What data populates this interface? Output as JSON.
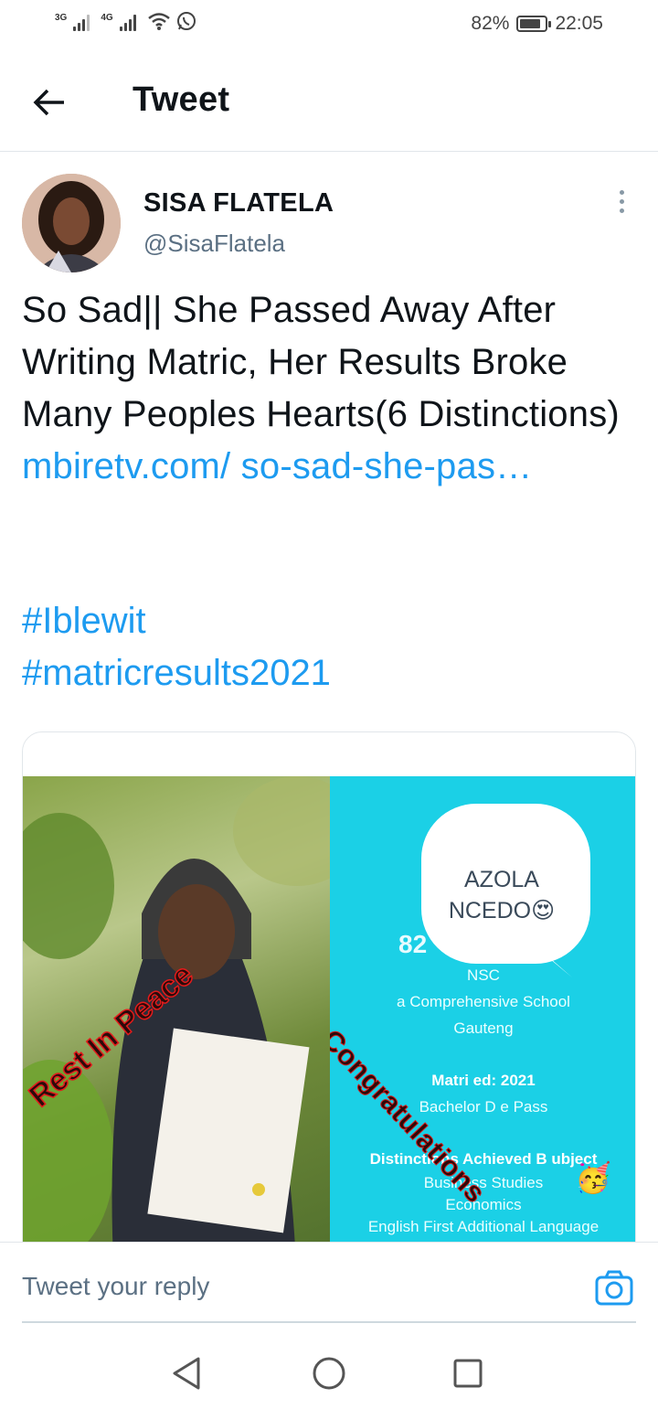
{
  "status_bar": {
    "network1": "3G",
    "network2": "4G",
    "battery_percent": "82%",
    "battery_level": 0.82,
    "time": "22:05",
    "icons": [
      "signal-icon",
      "signal-icon",
      "wifi-icon",
      "whatsapp-icon",
      "battery-icon"
    ]
  },
  "header": {
    "title": "Tweet",
    "back_icon": "arrow-left-icon"
  },
  "tweet": {
    "author_name": "SISA FLATELA",
    "author_handle": "@SisaFlatela",
    "text": "So Sad|| She Passed Away After Writing Matric, Her Results Broke Many Peoples Hearts(6 Distinctions) ",
    "link": "mbiretv.com/ so-sad-she-pas…",
    "hashtags": [
      "#Iblewit",
      "#matricresults2021"
    ],
    "accent_color": "#1d9bf0"
  },
  "media": {
    "left_overlay": "Rest In Peace",
    "right": {
      "name_line1": "AZOLA",
      "name_line2": "NCEDO",
      "partial_number": "82",
      "nsc": "NSC",
      "school": "a Comprehensive School",
      "province": "Gauteng",
      "matric_year": "Matri     ed: 2021",
      "pass": "Bachelor D       e Pass",
      "distinctions_heading": "Distinctions Achieved B   ubject",
      "subjects": [
        "Business Studies",
        "Economics",
        "English First Additional Language"
      ],
      "overlay": "Congratulations",
      "background_color": "#1bd0e6"
    }
  },
  "reply": {
    "placeholder": "Tweet your reply",
    "camera_icon": "camera-icon"
  },
  "nav": {
    "back": "nav-back-icon",
    "home": "nav-home-icon",
    "recents": "nav-recents-icon"
  }
}
